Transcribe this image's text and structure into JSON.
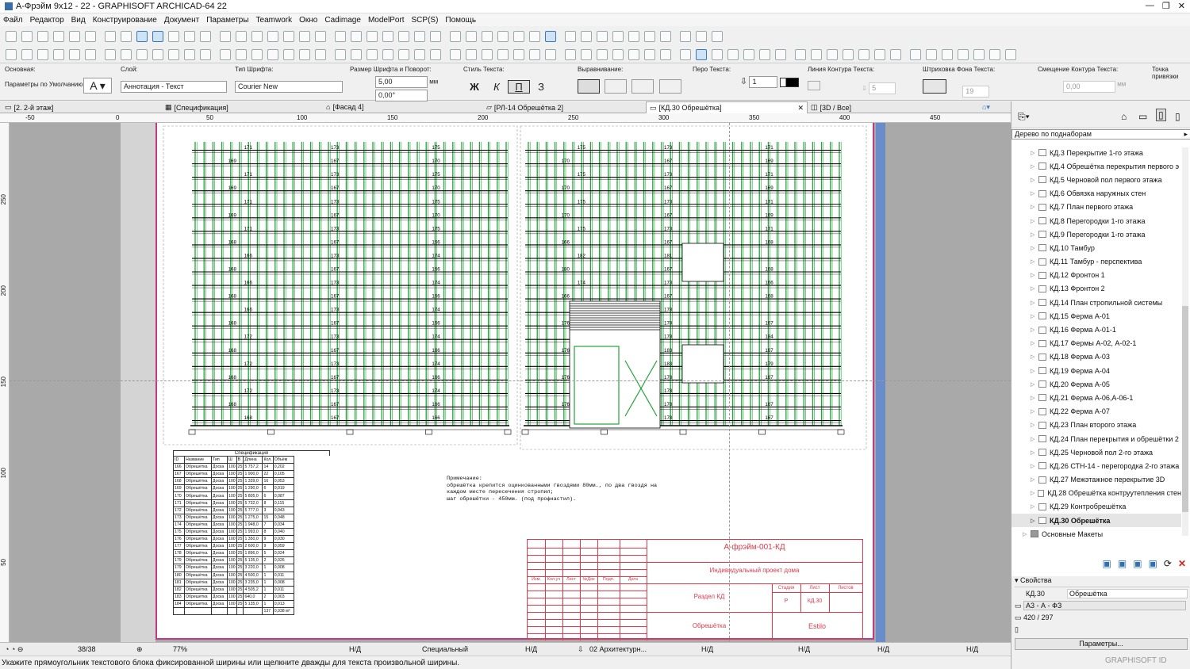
{
  "window": {
    "title": "А-Фрэйм 9х12 - 22 - GRAPHISOFT ARCHICAD-64 22"
  },
  "menu": [
    "Файл",
    "Редактор",
    "Вид",
    "Конструирование",
    "Документ",
    "Параметры",
    "Teamwork",
    "Окно",
    "Cadimage",
    "ModelPort",
    "SCP(S)",
    "Помощь"
  ],
  "infobox": {
    "main_label": "Основная:",
    "main_value": "Параметры по Умолчанию",
    "layer_label": "Слой:",
    "layer_value": "Аннотация - Текст",
    "font_label": "Тип Шрифта:",
    "font_value": "Courier New",
    "size_label": "Размер Шрифта и Поворот:",
    "size_value": "5,00",
    "size_unit": "мм",
    "angle_value": "0,00°",
    "style_label": "Стиль Текста:",
    "style_btns": [
      "Ж",
      "К",
      "П",
      "З"
    ],
    "align_label": "Выравнивание:",
    "pen_label": "Перо Текста:",
    "pen_value": "1",
    "contour_label": "Линия Контура Текста:",
    "contour_value": "5",
    "hatch_label": "Штриховка Фона Текста:",
    "hatch_value": "19",
    "offset_label": "Смещение Контура Текста:",
    "offset_value": "0,00",
    "offset_unit": "мм",
    "anchor_label": "Точка привязки"
  },
  "tabs": [
    "[2. 2-й этаж]",
    "[Спецификация]",
    "[Фасад 4]",
    "[РЛ-14 Обрешётка 2]",
    "[КД.30 Обрешётка]",
    "[3D / Все]"
  ],
  "ruler": [
    "-50",
    "0",
    "50",
    "100",
    "150",
    "200",
    "250",
    "300",
    "350",
    "400",
    "450"
  ],
  "vruler": [
    "250",
    "200",
    "150",
    "100",
    "50"
  ],
  "drawing": {
    "left_rows": [
      [
        "171",
        "173",
        "175"
      ],
      [
        "169",
        "167",
        "170"
      ],
      [
        "171",
        "173",
        "175"
      ],
      [
        "169",
        "167",
        "170"
      ],
      [
        "171",
        "173",
        "175"
      ],
      [
        "169",
        "167",
        "170"
      ],
      [
        "171",
        "173",
        "175"
      ],
      [
        "168",
        "167",
        "166"
      ],
      [
        "166",
        "173",
        "174"
      ],
      [
        "168",
        "167",
        "166"
      ],
      [
        "166",
        "173",
        "174"
      ],
      [
        "168",
        "167",
        "166"
      ],
      [
        "166",
        "173",
        "174"
      ],
      [
        "168",
        "167",
        "166"
      ],
      [
        "172",
        "173",
        "174"
      ],
      [
        "168",
        "167",
        "166"
      ],
      [
        "172",
        "173",
        "174"
      ],
      [
        "168",
        "167",
        "166"
      ],
      [
        "172",
        "173",
        "174"
      ],
      [
        "168",
        "167",
        "166"
      ],
      [
        "168",
        "167",
        "166"
      ]
    ],
    "right_rows": [
      [
        "175",
        "173",
        "171"
      ],
      [
        "170",
        "167",
        "169"
      ],
      [
        "175",
        "173",
        "171"
      ],
      [
        "170",
        "167",
        "169"
      ],
      [
        "175",
        "173",
        "171"
      ],
      [
        "170",
        "167",
        "169"
      ],
      [
        "175",
        "173",
        "171"
      ],
      [
        "166",
        "167",
        "168"
      ],
      [
        "182",
        "181",
        ""
      ],
      [
        "180",
        "167",
        "168"
      ],
      [
        "174",
        "173",
        "166"
      ],
      [
        "166",
        "167",
        "168"
      ],
      [
        "176",
        "178",
        ""
      ],
      [
        "176",
        "178",
        "167"
      ],
      [
        "176",
        "178",
        "184"
      ],
      [
        "176",
        "183",
        "167"
      ],
      [
        "176",
        "183",
        "179"
      ],
      [
        "176",
        "178",
        "167"
      ],
      [
        "176",
        "178",
        ""
      ],
      [
        "176",
        "178",
        "167"
      ],
      [
        "176",
        "178",
        "167"
      ]
    ]
  },
  "spec": {
    "title": "Спецификация",
    "headers": [
      "ID",
      "Название",
      "Тип",
      "Ш",
      "В",
      "Длина",
      "Кол.",
      "Объём"
    ],
    "rows": [
      [
        "166",
        "Обрешётка",
        "Доска",
        "100",
        "25",
        "5 757,2",
        "14",
        "0,202"
      ],
      [
        "167",
        "Обрешётка",
        "Доска",
        "100",
        "25",
        "1 900,0",
        "22",
        "0,105"
      ],
      [
        "168",
        "Обрешётка",
        "Доска",
        "100",
        "25",
        "1 339,0",
        "16",
        "0,053"
      ],
      [
        "169",
        "Обрешётка",
        "Доска",
        "100",
        "25",
        "1 290,0",
        "6",
        "0,019"
      ],
      [
        "170",
        "Обрешётка",
        "Доска",
        "100",
        "25",
        "5 805,0",
        "6",
        "0,087"
      ],
      [
        "171",
        "Обрешётка",
        "Доска",
        "100",
        "25",
        "5 732,0",
        "8",
        "0,115"
      ],
      [
        "172",
        "Обрешётка",
        "Доска",
        "100",
        "25",
        "5 777,0",
        "3",
        "0,043"
      ],
      [
        "173",
        "Обрешётка",
        "Доска",
        "100",
        "25",
        "1 275,0",
        "15",
        "0,048"
      ],
      [
        "174",
        "Обрешётка",
        "Доска",
        "100",
        "25",
        "1 948,0",
        "7",
        "0,034"
      ],
      [
        "175",
        "Обрешётка",
        "Доска",
        "100",
        "25",
        "1 993,0",
        "8",
        "0,040"
      ],
      [
        "176",
        "Обрешётка",
        "Доска",
        "100",
        "25",
        "1 350,0",
        "9",
        "0,030"
      ],
      [
        "177",
        "Обрешётка",
        "Доска",
        "100",
        "25",
        "2 600,0",
        "9",
        "0,059"
      ],
      [
        "178",
        "Обрешётка",
        "Доска",
        "100",
        "25",
        "1 896,0",
        "5",
        "0,024"
      ],
      [
        "179",
        "Обрешётка",
        "Доска",
        "100",
        "25",
        "5 135,0",
        "2",
        "0,026"
      ],
      [
        "179",
        "Обрешётка",
        "Доска",
        "100",
        "25",
        "3 220,0",
        "1",
        "0,008"
      ],
      [
        "180",
        "Обрешётка",
        "Доска",
        "100",
        "25",
        "4 500,0",
        "1",
        "0,011"
      ],
      [
        "181",
        "Обрешётка",
        "Доска",
        "100",
        "25",
        "3 235,0",
        "1",
        "0,008"
      ],
      [
        "182",
        "Обрешётка",
        "Доска",
        "100",
        "25",
        "4 505,2",
        "1",
        "0,011"
      ],
      [
        "183",
        "Обрешётка",
        "Доска",
        "100",
        "25",
        "640,0",
        "2",
        "0,003"
      ],
      [
        "184",
        "Обрешётка",
        "Доска",
        "100",
        "25",
        "5 135,0",
        "1",
        "0,013"
      ],
      [
        "",
        "",
        "",
        "",
        "",
        "",
        "137",
        "0,938 м³"
      ]
    ]
  },
  "note": "Примечание:\nобрешётка крепится оцинкованными гвоздями 80мм., по два гвоздя на\nкаждом месте пересечения стропил;\nшаг обрешётки - 450мм. (под профнастил).",
  "stamp": {
    "code": "А-фрэйм-001-КД",
    "project": "Индивидуальный проект дома",
    "cols": [
      "Изм.",
      "Кол.уч",
      "Лист",
      "№Док",
      "Подп.",
      "Дата"
    ],
    "section": "Раздел КД",
    "stage_label": "Стадия",
    "sheet_label": "Лист",
    "sheets_label": "Листов",
    "stage": "Р",
    "sheet": "КД.30",
    "name": "Обрешётка",
    "company": "Estilo"
  },
  "status": {
    "pages": "38/38",
    "zoom": "77%",
    "nd": "Н/Д",
    "view": "Специальный",
    "layer": "02 Архитектурн..."
  },
  "hint": "Укажите прямоугольник текстового блока фиксированной ширины или щелкните дважды для текста произвольной ширины.",
  "navigator": {
    "mode": "Дерево по поднаборам",
    "items": [
      "КД.3 Перекрытие 1-го этажа",
      "КД.4 Обрешётка перекрытия первого э",
      "КД.5 Черновой пол первого этажа",
      "КД.6 Обвязка наружных стен",
      "КД.7 План первого этажа",
      "КД.8 Перегородки 1-го этажа",
      "КД.9 Перегородки 1-го этажа",
      "КД.10 Тамбур",
      "КД.11 Тамбур - перспектива",
      "КД.12 Фронтон 1",
      "КД.13 Фронтон 2",
      "КД.14 План стропильной системы",
      "КД.15 Ферма А-01",
      "КД.16 Ферма А-01-1",
      "КД.17 Фермы А-02, А-02-1",
      "КД.18 Ферма А-03",
      "КД.19 Ферма А-04",
      "КД.20 Ферма А-05",
      "КД.21 Ферма А-06,А-06-1",
      "КД.22 Ферма А-07",
      "КД.23 План второго этажа",
      "КД.24 План перекрытия и обрешётки 2",
      "КД.25 Черновой пол 2-го этажа",
      "КД.26 СТН-14 - перегородка 2-го этажа",
      "КД.27 Межэтажное перекрытие 3D",
      "КД.28 Обрешётка контруутепления стен",
      "КД.29 Контробрешётка",
      "КД.30 Обрешётка"
    ],
    "folder": "Основные Макеты"
  },
  "props": {
    "title": "Свойства",
    "id": "КД.30",
    "name": "Обрешётка",
    "format": "А3 - А - ФЗ",
    "size": "420 / 297",
    "params_btn": "Параметры...",
    "brand": "GRAPHISOFT ID"
  }
}
